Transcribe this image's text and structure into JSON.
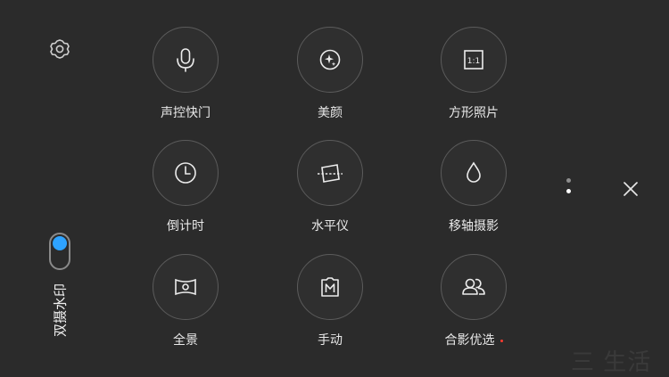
{
  "left": {
    "settings_icon": "gear-icon",
    "toggle_on": true,
    "toggle_color": "#2ea3ff",
    "dual_watermark_label": "双摄水印"
  },
  "modes": [
    {
      "label": "声控快门",
      "icon": "microphone-icon"
    },
    {
      "label": "美颜",
      "icon": "sparkle-icon"
    },
    {
      "label": "方形照片",
      "icon": "square-ratio-icon",
      "icon_text": "1:1"
    },
    {
      "label": "倒计时",
      "icon": "clock-icon"
    },
    {
      "label": "水平仪",
      "icon": "level-icon"
    },
    {
      "label": "移轴摄影",
      "icon": "drop-icon"
    },
    {
      "label": "全景",
      "icon": "panorama-icon"
    },
    {
      "label": "手动",
      "icon": "manual-icon"
    },
    {
      "label": "合影优选",
      "icon": "people-icon",
      "has_new_dot": true
    }
  ],
  "pager": {
    "pages": 2,
    "current": 2
  },
  "close_icon": "close-icon",
  "watermark_text": "三 生活"
}
